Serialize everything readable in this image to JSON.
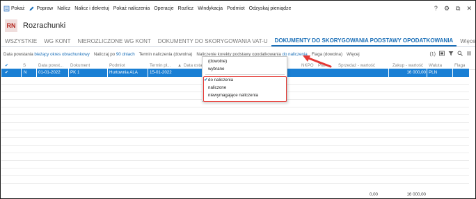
{
  "toolbar": {
    "items": [
      {
        "label": "Pokaż",
        "icon": "show-icon"
      },
      {
        "label": "Popraw",
        "icon": "pencil-icon"
      },
      {
        "label": "Nalicz"
      },
      {
        "label": "Nalicz i dekretuj"
      },
      {
        "label": "Pokaż naliczenia"
      },
      {
        "label": "Operacje"
      },
      {
        "label": "Rozlicz"
      },
      {
        "label": "Windykacja"
      },
      {
        "label": "Podmiot"
      },
      {
        "label": "Odzyskaj pieniądze"
      }
    ],
    "right": {
      "help": "?",
      "settings": "⚙",
      "restore": "⧉",
      "close": "✕"
    }
  },
  "header": {
    "logo": "RN",
    "title": "Rozrachunki"
  },
  "tabs": [
    {
      "label": "WSZYSTKIE",
      "active": false
    },
    {
      "label": "WG KONT",
      "active": false
    },
    {
      "label": "NIEROZLICZONE WG KONT",
      "active": false
    },
    {
      "label": "DOKUMENTY DO SKORYGOWANIA VAT-U",
      "active": false
    },
    {
      "label": "DOKUMENTY DO SKORYGOWANIA PODSTAWY OPODATKOWANIA",
      "active": true
    },
    {
      "label": "Więcej",
      "active": false
    }
  ],
  "filters": [
    {
      "label": "Data powstania",
      "value": "bieżący okres obrachunkowy"
    },
    {
      "label": "Naliczaj po",
      "value": "90 dniach"
    },
    {
      "label": "Termin naliczenia (dowolna)",
      "value": ""
    },
    {
      "label": "Naliczenie korekty podstawy opodatkowania",
      "value": "do naliczenia"
    },
    {
      "label": "Flaga (dowolna)",
      "value": ""
    },
    {
      "label": "Więcej",
      "value": ""
    }
  ],
  "filter_count": "(1)",
  "grid": {
    "headers": [
      "S",
      "Data powst...",
      "Dokument",
      "Podmiot",
      "Termin pł...",
      "Data ostat",
      "NKPO",
      "Płat",
      "Sprzedaż - wartość",
      "Zakup - wartość",
      "Waluta",
      "Flaga"
    ],
    "rows": [
      {
        "check": "✔",
        "s": "N",
        "data": "01-01-2022",
        "dokument": "PK 1",
        "podmiot": "Hurtownia ALA",
        "termin": "15-01-2022",
        "sprzedaz": "",
        "zakup": "16 000,00",
        "waluta": "PLN",
        "flaga": ""
      }
    ]
  },
  "footer": {
    "sprzedaz_total": "0,00",
    "zakup_total": "16 000,00"
  },
  "dropdown": {
    "options": [
      "(dowolne)",
      "wybrane",
      "do naliczenia",
      "naliczone",
      "niewymagające naliczenia"
    ],
    "selected": "do naliczenia"
  },
  "colors": {
    "accent": "#1a7fd4",
    "highlight": "#e53935",
    "logo_bg": "#f0dedd",
    "logo_text": "#b3261e"
  }
}
